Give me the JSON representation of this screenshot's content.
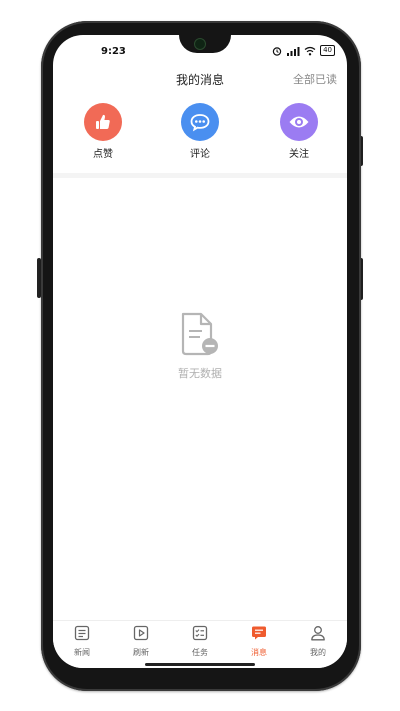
{
  "status": {
    "time": "9:23",
    "battery": "40"
  },
  "header": {
    "title": "我的消息",
    "mark_all_read": "全部已读"
  },
  "categories": [
    {
      "label": "点赞",
      "icon": "thumbs-up-icon",
      "color": "#f16a56"
    },
    {
      "label": "评论",
      "icon": "comment-icon",
      "color": "#4a8ff0"
    },
    {
      "label": "关注",
      "icon": "eye-icon",
      "color": "#9b7cf2"
    }
  ],
  "empty_state": {
    "text": "暂无数据",
    "icon": "document-remove-icon"
  },
  "tabbar": {
    "items": [
      {
        "label": "新闻",
        "icon": "news-icon"
      },
      {
        "label": "刷新",
        "icon": "play-square-icon"
      },
      {
        "label": "任务",
        "icon": "checklist-icon"
      },
      {
        "label": "消息",
        "icon": "message-icon",
        "active": true
      },
      {
        "label": "我的",
        "icon": "person-icon"
      }
    ],
    "active_color": "#ef5b2e"
  }
}
